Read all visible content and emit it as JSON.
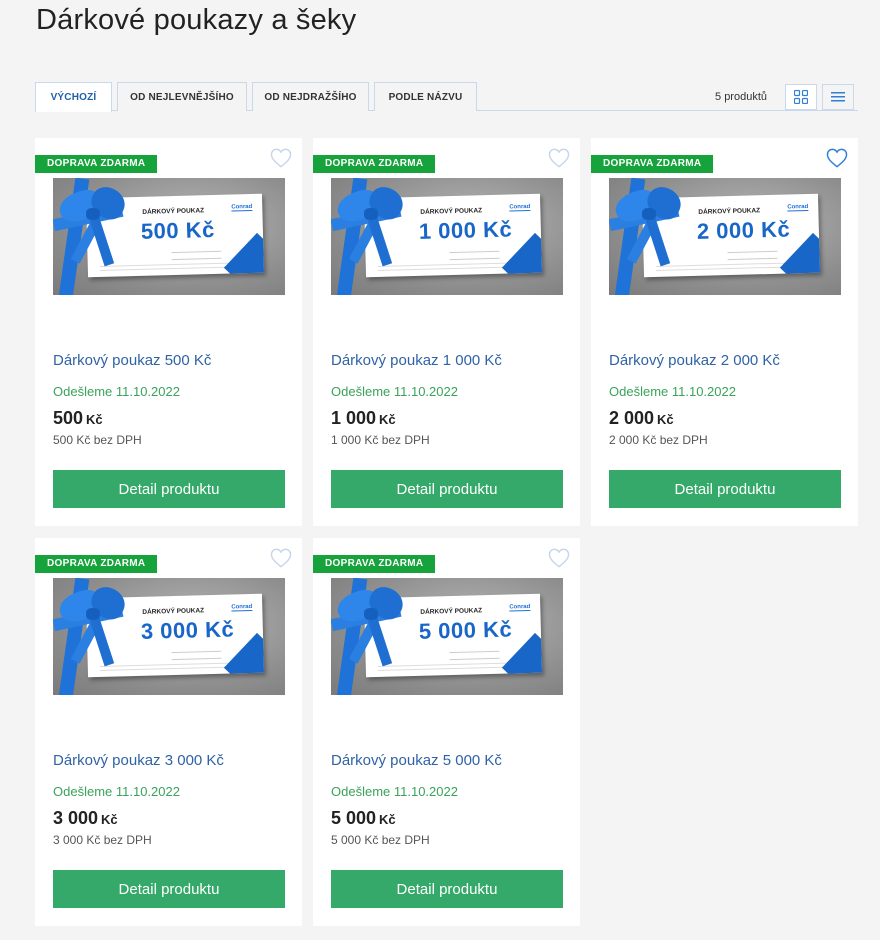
{
  "page": {
    "title": "Dárkové poukazy a šeky"
  },
  "sort": {
    "tabs": [
      {
        "label": "VÝCHOZÍ",
        "active": true
      },
      {
        "label": "OD NEJLEVNĚJŠÍHO",
        "active": false
      },
      {
        "label": "OD NEJDRAŽŠÍHO",
        "active": false
      },
      {
        "label": "PODLE NÁZVU",
        "active": false
      }
    ],
    "count": "5 produktů"
  },
  "icons": {
    "grid": "grid-view-icon",
    "list": "list-view-icon",
    "heart": "heart-icon"
  },
  "colors": {
    "accent_blue": "#2f63a6",
    "badge_green": "#17a33b",
    "button_green": "#34a96a",
    "ship_green": "#3aa35a",
    "heart_inactive": "#c7d6ea",
    "heart_active": "#2f7fd6"
  },
  "products": [
    {
      "badge": "DOPRAVA ZDARMA",
      "voucher_title": "DÁRKOVÝ POUKAZ",
      "voucher_logo": "Conrad",
      "voucher_amount": "500 Kč",
      "name": "Dárkový poukaz 500 Kč",
      "shipping": "Odešleme 11.10.2022",
      "price": "500",
      "currency": "Kč",
      "price_net": "500 Kč bez DPH",
      "button": "Detail produktu",
      "favorite": false
    },
    {
      "badge": "DOPRAVA ZDARMA",
      "voucher_title": "DÁRKOVÝ POUKAZ",
      "voucher_logo": "Conrad",
      "voucher_amount": "1 000 Kč",
      "name": "Dárkový poukaz 1 000 Kč",
      "shipping": "Odešleme 11.10.2022",
      "price": "1 000",
      "currency": "Kč",
      "price_net": "1 000 Kč bez DPH",
      "button": "Detail produktu",
      "favorite": false
    },
    {
      "badge": "DOPRAVA ZDARMA",
      "voucher_title": "DÁRKOVÝ POUKAZ",
      "voucher_logo": "Conrad",
      "voucher_amount": "2 000 Kč",
      "name": "Dárkový poukaz 2 000 Kč",
      "shipping": "Odešleme 11.10.2022",
      "price": "2 000",
      "currency": "Kč",
      "price_net": "2 000 Kč bez DPH",
      "button": "Detail produktu",
      "favorite": true
    },
    {
      "badge": "DOPRAVA ZDARMA",
      "voucher_title": "DÁRKOVÝ POUKAZ",
      "voucher_logo": "Conrad",
      "voucher_amount": "3 000 Kč",
      "name": "Dárkový poukaz 3 000 Kč",
      "shipping": "Odešleme 11.10.2022",
      "price": "3 000",
      "currency": "Kč",
      "price_net": "3 000 Kč bez DPH",
      "button": "Detail produktu",
      "favorite": false
    },
    {
      "badge": "DOPRAVA ZDARMA",
      "voucher_title": "DÁRKOVÝ POUKAZ",
      "voucher_logo": "Conrad",
      "voucher_amount": "5 000 Kč",
      "name": "Dárkový poukaz 5 000 Kč",
      "shipping": "Odešleme 11.10.2022",
      "price": "5 000",
      "currency": "Kč",
      "price_net": "5 000 Kč bez DPH",
      "button": "Detail produktu",
      "favorite": false
    }
  ]
}
